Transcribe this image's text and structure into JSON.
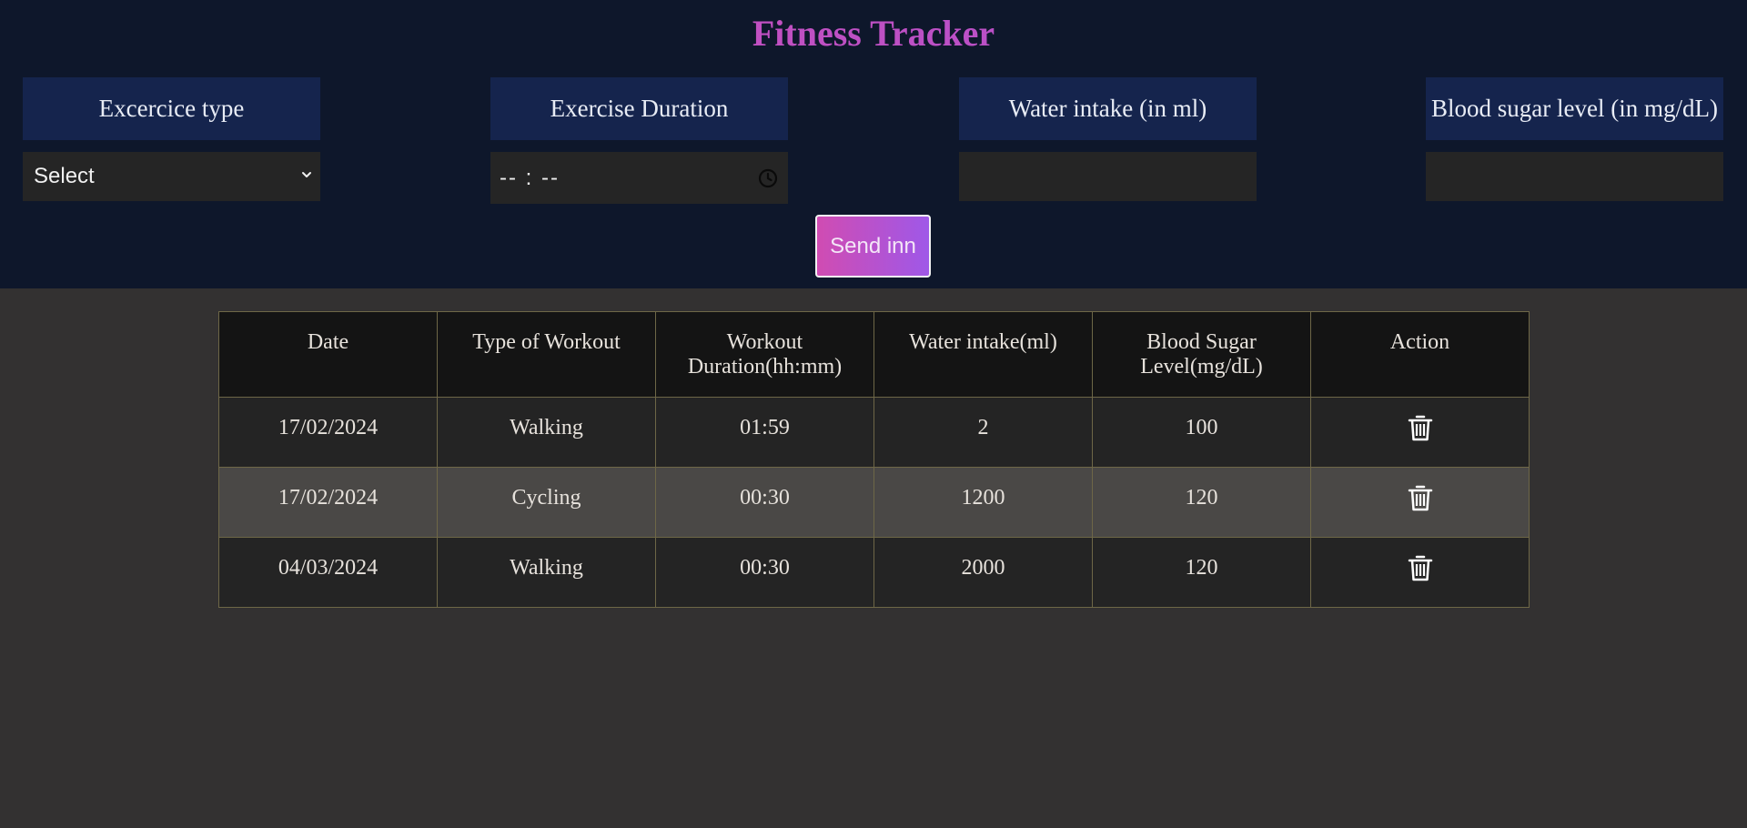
{
  "app": {
    "title": "Fitness Tracker"
  },
  "form": {
    "exercise_type": {
      "label": "Excercice type",
      "selected": "Select"
    },
    "exercise_duration": {
      "label": "Exercise Duration",
      "placeholder": "-- : --"
    },
    "water_intake": {
      "label": "Water intake (in ml)",
      "value": ""
    },
    "blood_sugar": {
      "label": "Blood sugar level (in mg/dL)",
      "value": ""
    },
    "submit_label": "Send inn"
  },
  "table": {
    "headers": {
      "date": "Date",
      "type": "Type of Workout",
      "duration": "Workout Duration(hh:mm)",
      "water": "Water intake(ml)",
      "sugar": "Blood Sugar Level(mg/dL)",
      "action": "Action"
    },
    "rows": [
      {
        "date": "17/02/2024",
        "type": "Walking",
        "duration": "01:59",
        "water": "2",
        "sugar": "100",
        "action_icon": "trash-icon"
      },
      {
        "date": "17/02/2024",
        "type": "Cycling",
        "duration": "00:30",
        "water": "1200",
        "sugar": "120",
        "action_icon": "trash-icon"
      },
      {
        "date": "04/03/2024",
        "type": "Walking",
        "duration": "00:30",
        "water": "2000",
        "sugar": "120",
        "action_icon": "trash-icon"
      }
    ]
  },
  "colors": {
    "header_bg": "#0e172b",
    "page_bg": "#333131",
    "label_bg": "#15244d",
    "accent_start": "#d24fb0",
    "accent_end": "#a950d8",
    "table_border": "#6e6747",
    "row_alt_bg": "#4a4846"
  }
}
